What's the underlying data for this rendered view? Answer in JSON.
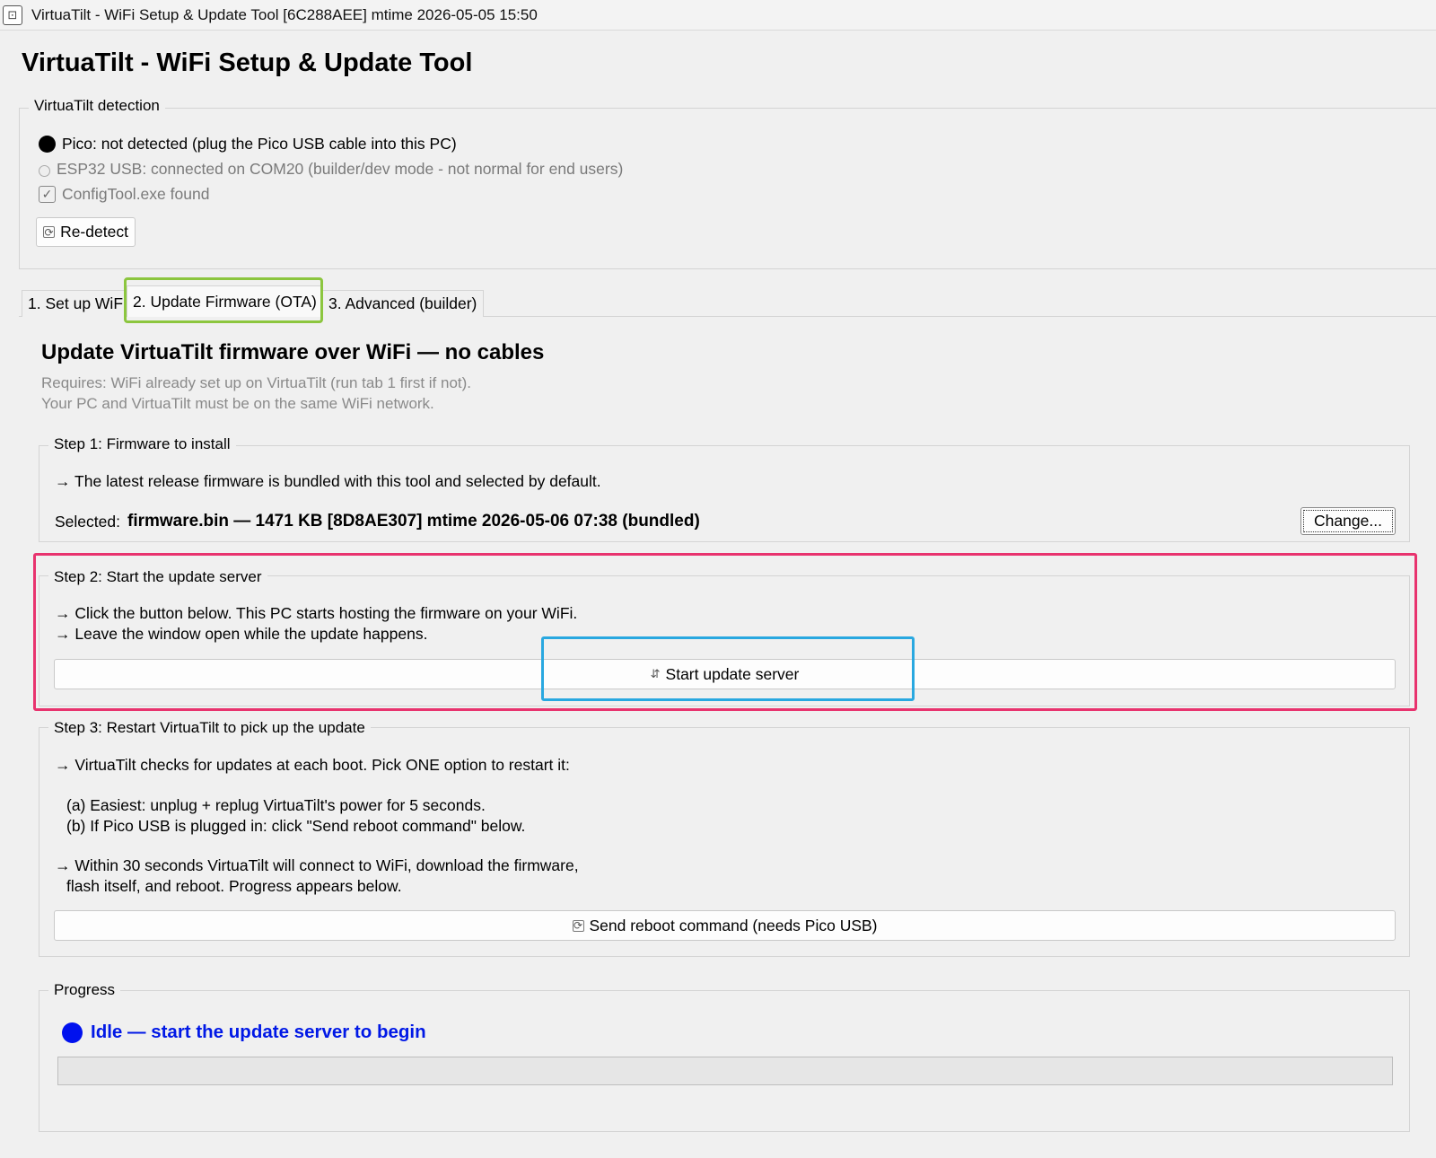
{
  "window": {
    "title": "VirtuaTilt - WiFi Setup & Update Tool  [6C288AEE] mtime 2026-05-05 15:50"
  },
  "header": {
    "title": "VirtuaTilt - WiFi Setup & Update Tool"
  },
  "detection": {
    "legend": "VirtuaTilt detection",
    "pico_status": "Pico: not detected  (plug the Pico USB cable into this PC)",
    "esp32_status": "ESP32 USB: connected on COM20  (builder/dev mode - not normal for end users)",
    "configtool_status": "ConfigTool.exe found",
    "configtool_checked": true,
    "redetect_label": "Re-detect"
  },
  "tabs": [
    {
      "label": "1. Set up WiFi"
    },
    {
      "label": "2. Update Firmware (OTA)"
    },
    {
      "label": "3. Advanced (builder)"
    }
  ],
  "active_tab": 1,
  "ota": {
    "heading": "Update VirtuaTilt firmware over WiFi — no cables",
    "req_line1": "Requires: WiFi already set up on VirtuaTilt (run tab 1 first if not).",
    "req_line2": "Your PC and VirtuaTilt must be on the same WiFi network.",
    "step1": {
      "legend": "Step 1: Firmware to install",
      "line1": "→ The latest release firmware is bundled with this tool and selected by default.",
      "selected_label": "Selected:",
      "selected_value": "firmware.bin — 1471 KB  [8D8AE307]  mtime 2026-05-06 07:38  (bundled)",
      "change_label": "Change..."
    },
    "step2": {
      "legend": "Step 2: Start the update server",
      "line1": "→ Click the button below.  This PC starts hosting the firmware on your WiFi.",
      "line2": "→ Leave the window open while the update happens.",
      "button_label": "Start update server"
    },
    "step3": {
      "legend": "Step 3: Restart VirtuaTilt to pick up the update",
      "line1": "→ VirtuaTilt checks for updates at each boot.  Pick ONE option to restart it:",
      "line2": "(a) Easiest: unplug + replug VirtuaTilt's power for 5 seconds.",
      "line3": "(b) If Pico USB is plugged in: click \"Send reboot command\" below.",
      "line4": "→ Within 30 seconds VirtuaTilt will connect to WiFi, download the firmware,",
      "line5": "flash itself, and reboot.  Progress appears below.",
      "button_label": "Send reboot command (needs Pico USB)"
    },
    "progress": {
      "legend": "Progress",
      "status": "Idle — start the update server to begin",
      "status_color": "#0018e6",
      "percent": 0
    }
  },
  "highlights": {
    "tab_color": "#8cc63f",
    "step2_color": "#e8336e",
    "button_color": "#29a8e0"
  }
}
